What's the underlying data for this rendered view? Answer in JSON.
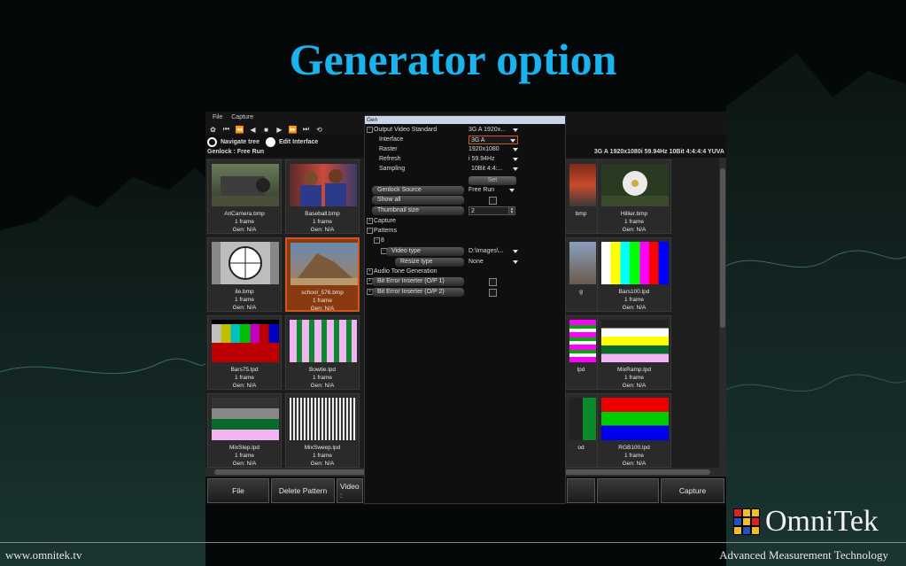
{
  "slide": {
    "title": "Generator option",
    "footer_left": "www.omnitek.tv",
    "footer_right": "Advanced Measurement Technology",
    "logo_text": "OmniTek"
  },
  "app": {
    "menu": [
      "File",
      "Capture"
    ],
    "navigate_label": "Navigate tree",
    "edit_label": "Edit Interface",
    "genlock_status": "Genlock : Free Run",
    "video_status": "3G A 1920x1080i 59.94Hz 10Bit 4:4:4:4 YUVA",
    "cells": [
      {
        "name": "AriCamera.bmp",
        "frames": "1 frame",
        "gen": "Gen: N/A"
      },
      {
        "name": "Baseball.bmp",
        "frames": "1 frame",
        "gen": "Gen: N/A"
      },
      {
        "name": "bmp",
        "frames": "",
        "gen": ""
      },
      {
        "name": "Hillier.bmp",
        "frames": "1 frame",
        "gen": "Gen: N/A"
      },
      {
        "name": "ite.bmp",
        "frames": "1 frame",
        "gen": "Gen: N/A"
      },
      {
        "name": "school_576.bmp",
        "frames": "1 frame",
        "gen": "Gen: N/A"
      },
      {
        "name": "g",
        "frames": "",
        "gen": ""
      },
      {
        "name": "Bars100.lpd",
        "frames": "1 frame",
        "gen": "Gen: N/A"
      },
      {
        "name": "Bars75.lpd",
        "frames": "1 frame",
        "gen": "Gen: N/A"
      },
      {
        "name": "Bowtie.lpd",
        "frames": "1 frame",
        "gen": "Gen: N/A"
      },
      {
        "name": "lpd",
        "frames": "",
        "gen": ""
      },
      {
        "name": "MixRamp.lpd",
        "frames": "1 frame",
        "gen": "Gen: N/A"
      },
      {
        "name": "MixStep.lpd",
        "frames": "1 frame",
        "gen": "Gen: N/A"
      },
      {
        "name": "MixSweep.lpd",
        "frames": "1 frame",
        "gen": "Gen: N/A"
      },
      {
        "name": "od",
        "frames": "",
        "gen": ""
      },
      {
        "name": "RGB100.lpd",
        "frames": "1 frame",
        "gen": "Gen: N/A"
      }
    ],
    "buttons": {
      "file": "File",
      "delete": "Delete Pattern",
      "video": "Video :",
      "capture": "Capture"
    }
  },
  "gen": {
    "title": "Gen",
    "output_video_standard": {
      "label": "Output Video Standard",
      "value": "3G A 1920x..."
    },
    "interface": {
      "label": "Interface",
      "value": "3G A"
    },
    "raster": {
      "label": "Raster",
      "value": "1920x1080"
    },
    "refresh": {
      "label": "Refresh",
      "value": "i 59.94Hz"
    },
    "sampling": {
      "label": "Sampling",
      "value": "10Bit 4:4:..."
    },
    "set_label": "Set",
    "genlock_source": {
      "label": "Genlock Source",
      "value": "Free Run"
    },
    "show_all": "Show all",
    "thumbnail_size": {
      "label": "Thumbnail size",
      "value": "2"
    },
    "capture": "Capture",
    "patterns": "Patterns",
    "pattern_node": "8",
    "video_type": {
      "label": "Video type",
      "value": "D:\\Images\\..."
    },
    "resize_type": {
      "label": "Resize type",
      "value": "None"
    },
    "audio_tone": "Audio Tone Generation",
    "bei1": "Bit Error Inserter (O/P 1)",
    "bei2": "Bit Error Inserter (O/P 2)"
  },
  "colors": {
    "title": "#1ab3ee",
    "selection": "#d0581c"
  }
}
